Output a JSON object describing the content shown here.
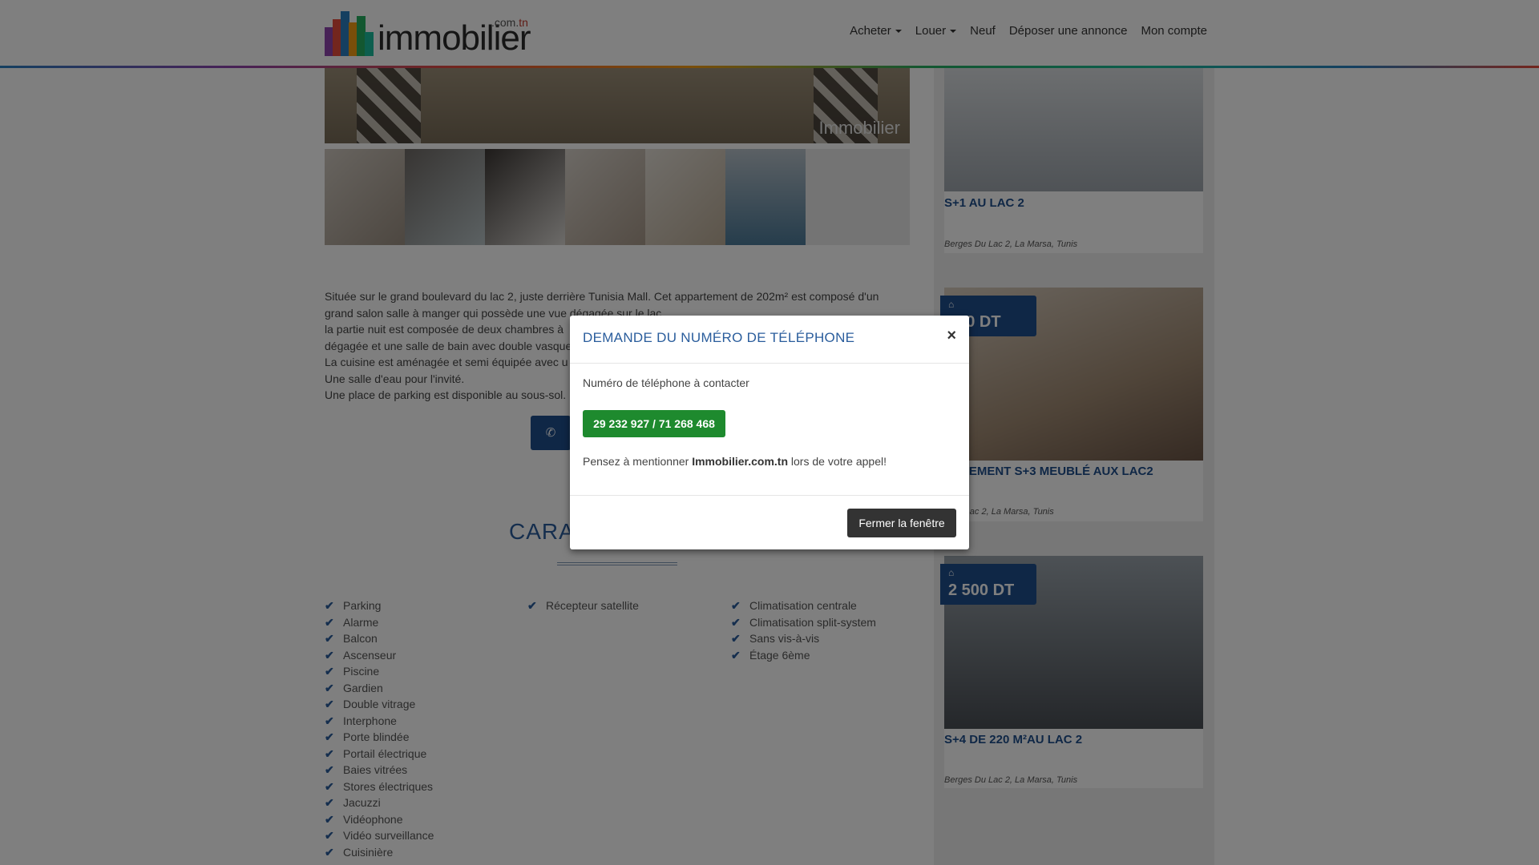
{
  "header": {
    "logo_text": "immobilier",
    "logo_tld_prefix": ".com.",
    "logo_tld_suffix": "tn",
    "nav": [
      "Acheter",
      "Louer",
      "Neuf",
      "Déposer une annonce",
      "Mon compte"
    ]
  },
  "listing": {
    "hero_watermark": "Immobilier",
    "description": [
      "Située sur le grand boulevard du lac 2, juste derrière Tunisia Mall. Cet appartement de 202m² est composé d'un",
      "grand salon salle à manger qui possède une vue dégagée sur le lac",
      "la partie nuit est composée de deux chambres à",
      "dégagée et une salle de bain avec double vasque",
      "La cuisine est aménagée et semi équipée avec u",
      "Une salle d'eau pour l'invité.",
      "Une place de parking est disponible au sous-sol."
    ],
    "section_title": "CARA",
    "features_col1": [
      "Parking",
      "Alarme",
      "Balcon",
      "Ascenseur",
      "Piscine",
      "Gardien",
      "Double vitrage",
      "Interphone",
      "Porte blindée",
      "Portail électrique",
      "Baies vitrées",
      "Stores électriques",
      "Jacuzzi",
      "Vidéophone",
      "Vidéo surveillance",
      "Cuisinière"
    ],
    "features_col2": [
      "Récepteur satellite"
    ],
    "features_col3": [
      "Climatisation centrale",
      "Climatisation split-system",
      "Sans vis-à-vis",
      "Étage 6ème"
    ]
  },
  "sidebar": {
    "cards": [
      {
        "title": "S+1 AU LAC 2",
        "location": "Berges Du Lac 2, La Marsa, Tunis",
        "price": ""
      },
      {
        "title": "ARTEMENT S+3 MEUBLÉ AUX LAC2",
        "location": "s Du Lac 2, La Marsa, Tunis",
        "price": "500 DT"
      },
      {
        "title": "S+4 DE 220 M²AU LAC 2",
        "location": "Berges Du Lac 2, La Marsa, Tunis",
        "price": "2 500 DT"
      }
    ]
  },
  "modal": {
    "title": "DEMANDE DU NUMÉRO DE TÉLÉPHONE",
    "close_symbol": "×",
    "label": "Numéro de téléphone à contacter",
    "phone": "29 232 927 / 71 268 468",
    "note_prefix": "Pensez à mentionner ",
    "note_brand": "Immobilier.com.tn",
    "note_suffix": " lors de votre appel!",
    "close_button": "Fermer la fenêtre"
  }
}
